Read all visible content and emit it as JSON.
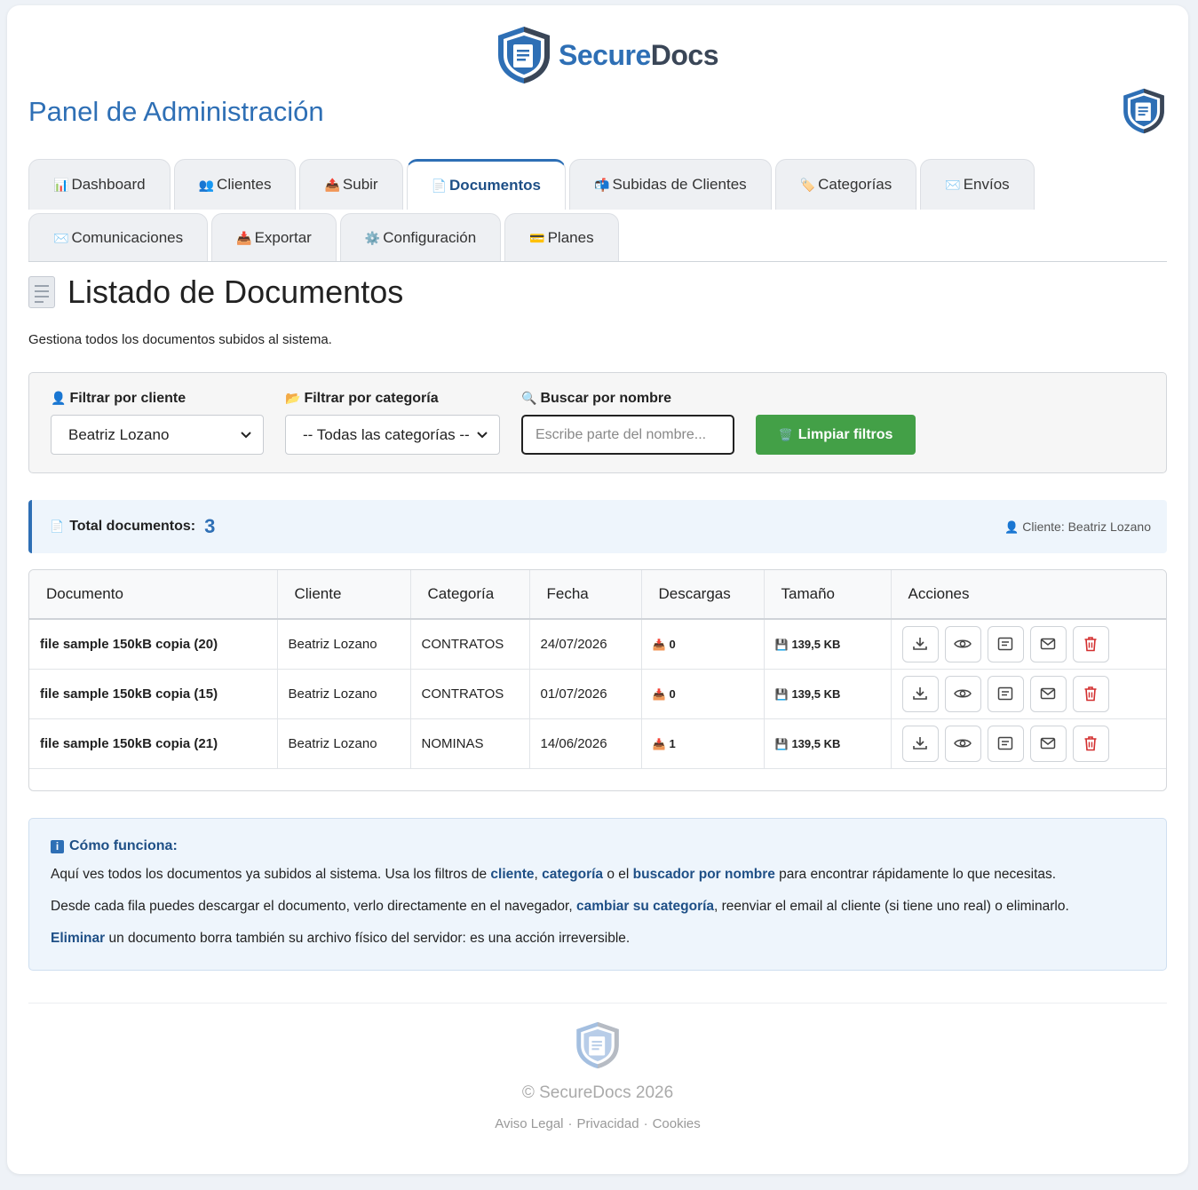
{
  "brand": {
    "part1": "Secure",
    "part2": "Docs"
  },
  "panel_title": "Panel de Administración",
  "tabs_row1": [
    {
      "icon": "📊",
      "label": "Dashboard"
    },
    {
      "icon": "👥",
      "label": "Clientes"
    },
    {
      "icon": "📤",
      "label": "Subir"
    },
    {
      "icon": "📄",
      "label": "Documentos"
    },
    {
      "icon": "📬",
      "label": "Subidas de Clientes"
    },
    {
      "icon": "🏷️",
      "label": "Categorías"
    },
    {
      "icon": "✉️",
      "label": "Envíos"
    }
  ],
  "tabs_row2": [
    {
      "icon": "✉️",
      "label": "Comunicaciones"
    },
    {
      "icon": "📥",
      "label": "Exportar"
    },
    {
      "icon": "⚙️",
      "label": "Configuración"
    },
    {
      "icon": "💳",
      "label": "Planes"
    }
  ],
  "active_tab": "Documentos",
  "section": {
    "title": "Listado de Documentos",
    "subtitle": "Gestiona todos los documentos subidos al sistema."
  },
  "filters": {
    "client_label": "Filtrar por cliente",
    "client_value": "Beatriz Lozano",
    "category_label": "Filtrar por categoría",
    "category_value": "-- Todas las categorías --",
    "search_label": "Buscar por nombre",
    "search_placeholder": "Escribe parte del nombre...",
    "clear_label": "Limpiar filtros"
  },
  "total": {
    "label": "Total documentos:",
    "count": "3",
    "client_text": "Cliente: Beatriz Lozano"
  },
  "table": {
    "headers": [
      "Documento",
      "Cliente",
      "Categoría",
      "Fecha",
      "Descargas",
      "Tamaño",
      "Acciones"
    ],
    "rows": [
      {
        "name": "file sample 150kB copia (20)",
        "client": "Beatriz Lozano",
        "category": "CONTRATOS",
        "date": "24/07/2026",
        "downloads": "0",
        "size": "139,5 KB"
      },
      {
        "name": "file sample 150kB copia (15)",
        "client": "Beatriz Lozano",
        "category": "CONTRATOS",
        "date": "01/07/2026",
        "downloads": "0",
        "size": "139,5 KB"
      },
      {
        "name": "file sample 150kB copia (21)",
        "client": "Beatriz Lozano",
        "category": "NOMINAS",
        "date": "14/06/2026",
        "downloads": "1",
        "size": "139,5 KB"
      }
    ]
  },
  "info": {
    "title": "Cómo funciona:",
    "p1_a": "Aquí ves todos los documentos ya subidos al sistema. Usa los filtros de ",
    "p1_b": "cliente",
    "p1_c": ", ",
    "p1_d": "categoría",
    "p1_e": " o el ",
    "p1_f": "buscador por nombre",
    "p1_g": " para encontrar rápidamente lo que necesitas.",
    "p2_a": "Desde cada fila puedes descargar el documento, verlo directamente en el navegador, ",
    "p2_b": "cambiar su categoría",
    "p2_c": ", reenviar el email al cliente (si tiene uno real) o eliminarlo.",
    "p3_a": "Eliminar",
    "p3_b": " un documento borra también su archivo físico del servidor: es una acción irreversible."
  },
  "footer": {
    "copyright": "© SecureDocs 2026",
    "links": [
      "Aviso Legal",
      "Privacidad",
      "Cookies"
    ]
  },
  "colors": {
    "accent": "#2e6fb5",
    "brand_dark": "#3a4657",
    "success": "#43a047",
    "danger": "#d32f2f"
  }
}
